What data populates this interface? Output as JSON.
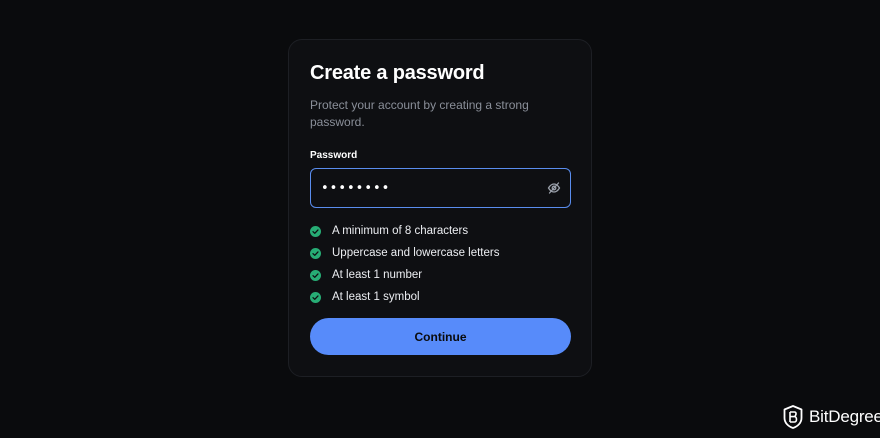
{
  "form": {
    "title": "Create a password",
    "subtitle": "Protect your account by creating a strong password.",
    "password_label": "Password",
    "password_value": "••••••••",
    "toggle_icon": "eye-off-icon",
    "requirements": [
      {
        "label": "A minimum of 8 characters",
        "met": true
      },
      {
        "label": "Uppercase and lowercase letters",
        "met": true
      },
      {
        "label": "At least 1 number",
        "met": true
      },
      {
        "label": "At least 1 symbol",
        "met": true
      }
    ],
    "continue_label": "Continue"
  },
  "watermark": {
    "name": "BitDegree"
  },
  "colors": {
    "background": "#0a0b0d",
    "card": "#0e0f12",
    "accent": "#578bfa",
    "input_border": "#5a8dee",
    "success": "#27ad75",
    "muted_text": "#8a8f99"
  }
}
